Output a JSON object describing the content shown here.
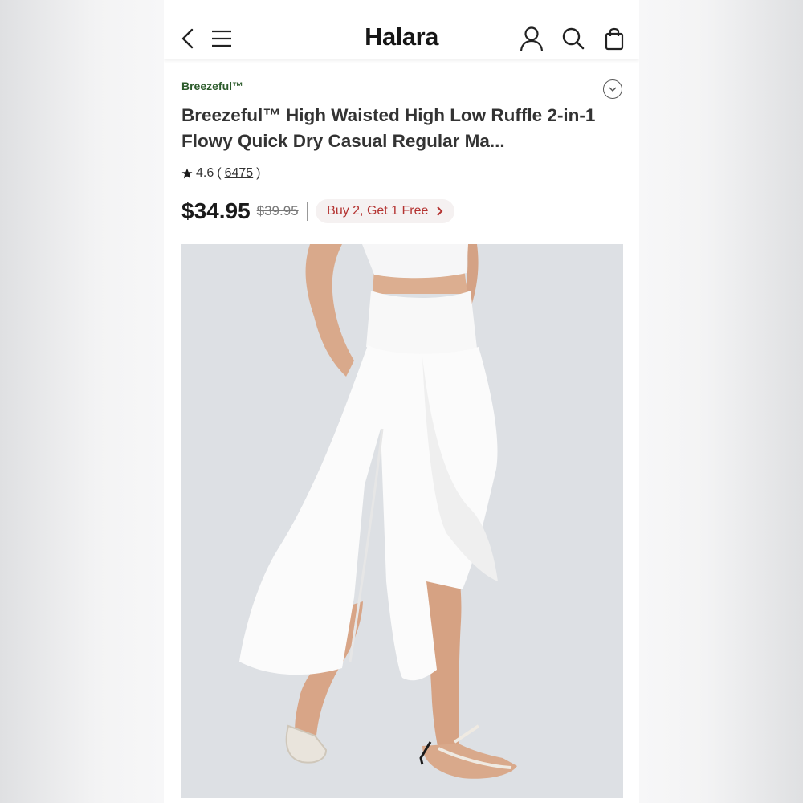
{
  "header": {
    "logo": "Halara",
    "icons": [
      "back-icon",
      "menu-icon",
      "account-icon",
      "search-icon",
      "bag-icon"
    ]
  },
  "product": {
    "brand": "Breezeful™",
    "title": "Breezeful™ High Waisted High Low Ruffle 2-in-1 Flowy Quick Dry Casual Regular Ma...",
    "rating": "4.6",
    "rating_open": "(",
    "review_count": "6475",
    "rating_close": ")",
    "price": "$34.95",
    "original_price": "$39.95",
    "promo": "Buy 2, Get 1 Free"
  },
  "colors": {
    "brand_green": "#2c5b2b",
    "promo_red": "#b43331",
    "promo_bg": "#f5f1f1",
    "image_bg": "#dde0e4"
  }
}
